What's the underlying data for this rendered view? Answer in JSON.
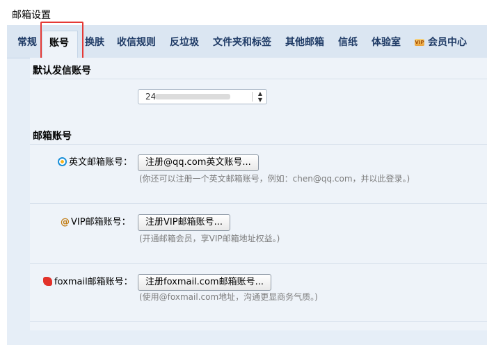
{
  "page_title": "邮箱设置",
  "tabs": [
    {
      "label": "常规",
      "active": false
    },
    {
      "label": "账号",
      "active": true
    },
    {
      "label": "换肤",
      "active": false
    },
    {
      "label": "收信规则",
      "active": false
    },
    {
      "label": "反垃圾",
      "active": false
    },
    {
      "label": "文件夹和标签",
      "active": false
    },
    {
      "label": "其他邮箱",
      "active": false
    },
    {
      "label": "信纸",
      "active": false
    },
    {
      "label": "体验室",
      "active": false
    },
    {
      "label": "会员中心",
      "active": false,
      "icon": "vip-badge-icon"
    }
  ],
  "default_sender": {
    "heading": "默认发信账号",
    "select_value": "24"
  },
  "mailbox_accounts": {
    "heading": "邮箱账号",
    "rows": [
      {
        "icon": "qq-mail-icon",
        "label": "英文邮箱账号：",
        "button": "注册@qq.com英文账号...",
        "hint": "(你还可以注册一个英文邮箱账号，例如：chen@qq.com，并以此登录。)"
      },
      {
        "icon": "at-sign-icon",
        "label": "VIP邮箱账号：",
        "button": "注册VIP邮箱账号...",
        "hint": "(开通邮箱会员，享VIP邮箱地址权益。)"
      },
      {
        "icon": "foxmail-icon",
        "label": "foxmail邮箱账号：",
        "button": "注册foxmail.com邮箱账号...",
        "hint": "(使用@foxmail.com地址，沟通更显商务气质。)"
      }
    ]
  },
  "colors": {
    "highlight_box": "#e53935",
    "tab_text": "#1f3b66",
    "tab_bar": "#dbe6f2",
    "content_bg": "#eef3f9",
    "hint_text": "#7d7d7d"
  }
}
